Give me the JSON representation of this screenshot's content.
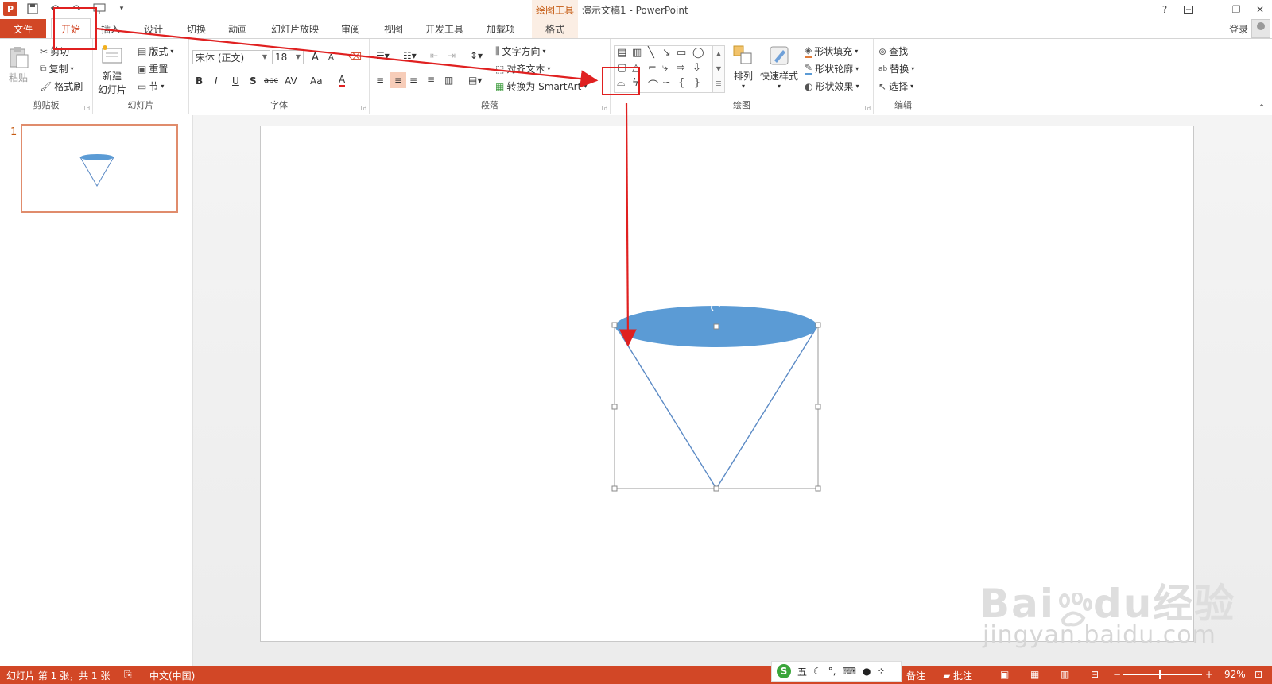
{
  "titlebar": {
    "context_tool": "绘图工具",
    "document_title": "演示文稿1 - PowerPoint",
    "help": "?",
    "minimize": "—",
    "restore": "❐",
    "close": "✕"
  },
  "tabs": [
    {
      "label": "文件"
    },
    {
      "label": "开始"
    },
    {
      "label": "插入"
    },
    {
      "label": "设计"
    },
    {
      "label": "切换"
    },
    {
      "label": "动画"
    },
    {
      "label": "幻灯片放映"
    },
    {
      "label": "审阅"
    },
    {
      "label": "视图"
    },
    {
      "label": "开发工具"
    },
    {
      "label": "加载项"
    },
    {
      "label": "格式"
    }
  ],
  "account": {
    "login": "登录"
  },
  "ribbon": {
    "clipboard": {
      "label": "剪贴板",
      "paste": "粘贴",
      "cut": "剪切",
      "copy": "复制",
      "format_painter": "格式刷"
    },
    "slides": {
      "label": "幻灯片",
      "new_slide_1": "新建",
      "new_slide_2": "幻灯片",
      "layout": "版式",
      "reset": "重置",
      "section": "节"
    },
    "font": {
      "label": "字体",
      "font_name": "宋体 (正文)",
      "font_size": "18",
      "grow": "A",
      "shrink": "A",
      "bold": "B",
      "italic": "I",
      "underline": "U",
      "shadow": "S",
      "strike": "abc",
      "spacing": "AV",
      "case": "Aa",
      "color": "A"
    },
    "paragraph": {
      "label": "段落",
      "text_direction": "文字方向",
      "align_text": "对齐文本",
      "smartart": "转换为 SmartArt"
    },
    "drawing": {
      "label": "绘图",
      "arrange": "排列",
      "quick_styles": "快速样式",
      "shape_fill": "形状填充",
      "shape_outline": "形状轮廓",
      "shape_effects": "形状效果"
    },
    "editing": {
      "label": "编辑",
      "find": "查找",
      "replace": "替换",
      "select": "选择"
    }
  },
  "thumbnails": [
    {
      "number": "1"
    }
  ],
  "statusbar": {
    "slide_info": "幻灯片 第 1 张，共 1 张",
    "language": "中文(中国)",
    "ime_mode": "五",
    "notes": "备注",
    "comments": "批注",
    "zoom": "92%",
    "zoom_minus": "−",
    "zoom_plus": "+"
  },
  "watermark": {
    "site": "jingyan.baidu.com",
    "logo_text": "Bai",
    "logo_text_2": "du",
    "logo_text_3": "经验"
  },
  "colors": {
    "accent": "#d24726",
    "shape_fill": "#5b9bd5",
    "shape_line": "#5b8ac5",
    "annotation": "#e02020"
  }
}
